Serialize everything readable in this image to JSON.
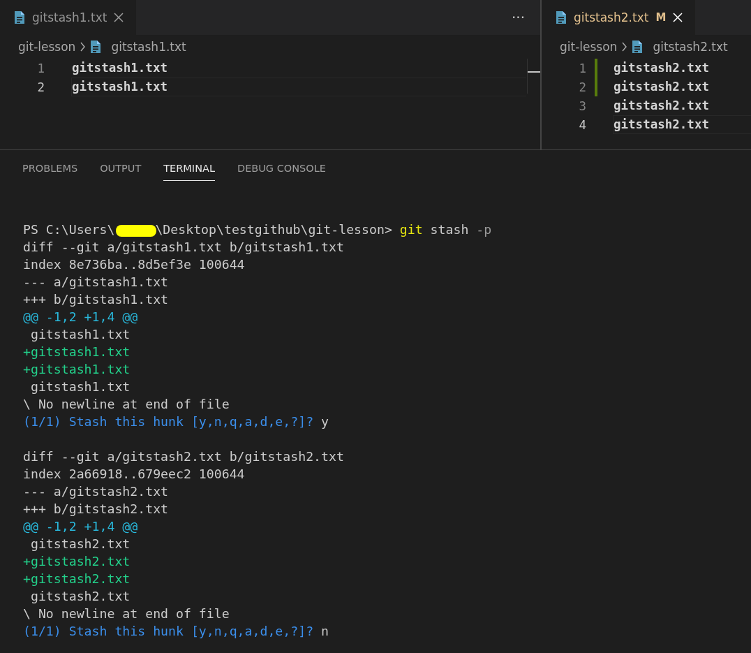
{
  "editors": [
    {
      "tab": {
        "label": "gitstash1.txt",
        "focused": false
      },
      "more_actions": "···",
      "breadcrumb": [
        "git-lesson",
        "gitstash1.txt"
      ],
      "lines": [
        {
          "number": "1",
          "text": "gitstash1.txt",
          "current": false,
          "added": false
        },
        {
          "number": "2",
          "text": "gitstash1.txt",
          "current": true,
          "added": false
        }
      ]
    },
    {
      "tab": {
        "label": "gitstash2.txt",
        "focused": true,
        "status": "M"
      },
      "breadcrumb": [
        "git-lesson",
        "gitstash2.txt"
      ],
      "lines": [
        {
          "number": "1",
          "text": "gitstash2.txt",
          "current": false,
          "added": true
        },
        {
          "number": "2",
          "text": "gitstash2.txt",
          "current": false,
          "added": true
        },
        {
          "number": "3",
          "text": "gitstash2.txt",
          "current": false,
          "added": false
        },
        {
          "number": "4",
          "text": "gitstash2.txt",
          "current": true,
          "added": false
        }
      ]
    }
  ],
  "panel": {
    "tabs": [
      {
        "label": "PROBLEMS",
        "selected": false
      },
      {
        "label": "OUTPUT",
        "selected": false
      },
      {
        "label": "TERMINAL",
        "selected": true
      },
      {
        "label": "DEBUG CONSOLE",
        "selected": false
      }
    ],
    "terminal": [
      {
        "segments": [
          {
            "kind": "plain",
            "text": "PS C:\\Users\\"
          },
          {
            "kind": "redaction"
          },
          {
            "kind": "plain",
            "text": "\\Desktop\\testgithub\\git-lesson> "
          },
          {
            "kind": "command",
            "text": "git"
          },
          {
            "kind": "plain",
            "text": " stash "
          },
          {
            "kind": "option",
            "text": "-p"
          }
        ]
      },
      {
        "segments": [
          {
            "kind": "plain",
            "text": "diff --git a/gitstash1.txt b/gitstash1.txt"
          }
        ]
      },
      {
        "segments": [
          {
            "kind": "plain",
            "text": "index 8e736ba..8d5ef3e 100644"
          }
        ]
      },
      {
        "segments": [
          {
            "kind": "plain",
            "text": "--- a/gitstash1.txt"
          }
        ]
      },
      {
        "segments": [
          {
            "kind": "plain",
            "text": "+++ b/gitstash1.txt"
          }
        ]
      },
      {
        "segments": [
          {
            "kind": "hunk",
            "text": "@@ -1,2 +1,4 @@"
          }
        ]
      },
      {
        "segments": [
          {
            "kind": "plain",
            "text": " gitstash1.txt"
          }
        ]
      },
      {
        "segments": [
          {
            "kind": "added",
            "text": "+gitstash1.txt"
          }
        ]
      },
      {
        "segments": [
          {
            "kind": "added",
            "text": "+gitstash1.txt"
          }
        ]
      },
      {
        "segments": [
          {
            "kind": "plain",
            "text": " gitstash1.txt"
          }
        ]
      },
      {
        "segments": [
          {
            "kind": "plain",
            "text": "\\ No newline at end of file"
          }
        ]
      },
      {
        "segments": [
          {
            "kind": "question",
            "text": "(1/1) Stash this hunk [y,n,q,a,d,e,?]? "
          },
          {
            "kind": "plain",
            "text": "y"
          }
        ]
      },
      {
        "gap_before": true,
        "segments": [
          {
            "kind": "plain",
            "text": "diff --git a/gitstash2.txt b/gitstash2.txt"
          }
        ]
      },
      {
        "segments": [
          {
            "kind": "plain",
            "text": "index 2a66918..679eec2 100644"
          }
        ]
      },
      {
        "segments": [
          {
            "kind": "plain",
            "text": "--- a/gitstash2.txt"
          }
        ]
      },
      {
        "segments": [
          {
            "kind": "plain",
            "text": "+++ b/gitstash2.txt"
          }
        ]
      },
      {
        "segments": [
          {
            "kind": "hunk",
            "text": "@@ -1,2 +1,4 @@"
          }
        ]
      },
      {
        "segments": [
          {
            "kind": "plain",
            "text": " gitstash2.txt"
          }
        ]
      },
      {
        "segments": [
          {
            "kind": "added",
            "text": "+gitstash2.txt"
          }
        ]
      },
      {
        "segments": [
          {
            "kind": "added",
            "text": "+gitstash2.txt"
          }
        ]
      },
      {
        "segments": [
          {
            "kind": "plain",
            "text": " gitstash2.txt"
          }
        ]
      },
      {
        "segments": [
          {
            "kind": "plain",
            "text": "\\ No newline at end of file"
          }
        ]
      },
      {
        "segments": [
          {
            "kind": "question",
            "text": "(1/1) Stash this hunk [y,n,q,a,d,e,?]? "
          },
          {
            "kind": "plain",
            "text": "n"
          }
        ]
      }
    ]
  }
}
